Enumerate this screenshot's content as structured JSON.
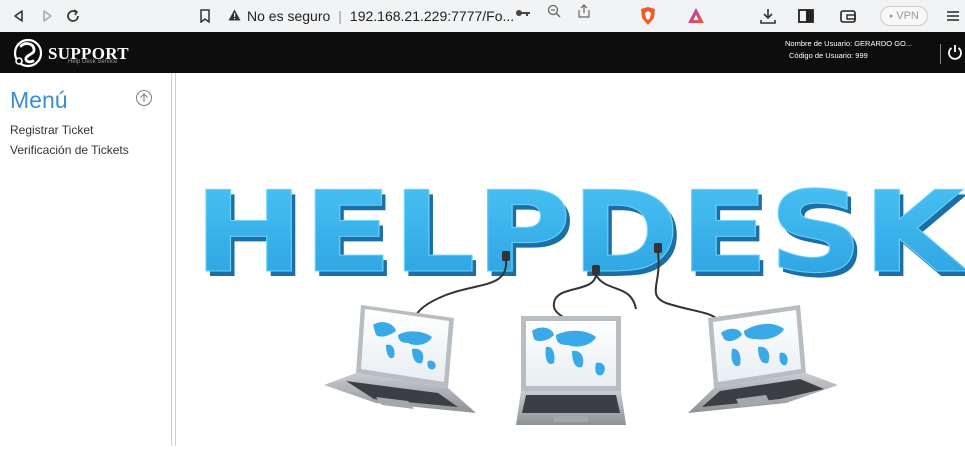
{
  "browser": {
    "security_label": "No es seguro",
    "url": "192.168.21.229:7777/Fo...",
    "vpn_label": "VPN"
  },
  "app": {
    "logo_text": "SUPPORT",
    "logo_sub": "Help Desk Service",
    "user_name_line": "Nombre de Usuario: GERARDO GO...",
    "user_code_line": "Código de Usuario: 999"
  },
  "sidebar": {
    "title": "Menú",
    "items": [
      {
        "label": "Registrar Ticket"
      },
      {
        "label": "Verificación de Tickets"
      }
    ]
  },
  "banner": {
    "word": "HELPDESK"
  },
  "colors": {
    "accent": "#3a8fd1",
    "banner_blue": "#38b1ee",
    "header_bg": "#0d0d0d"
  }
}
